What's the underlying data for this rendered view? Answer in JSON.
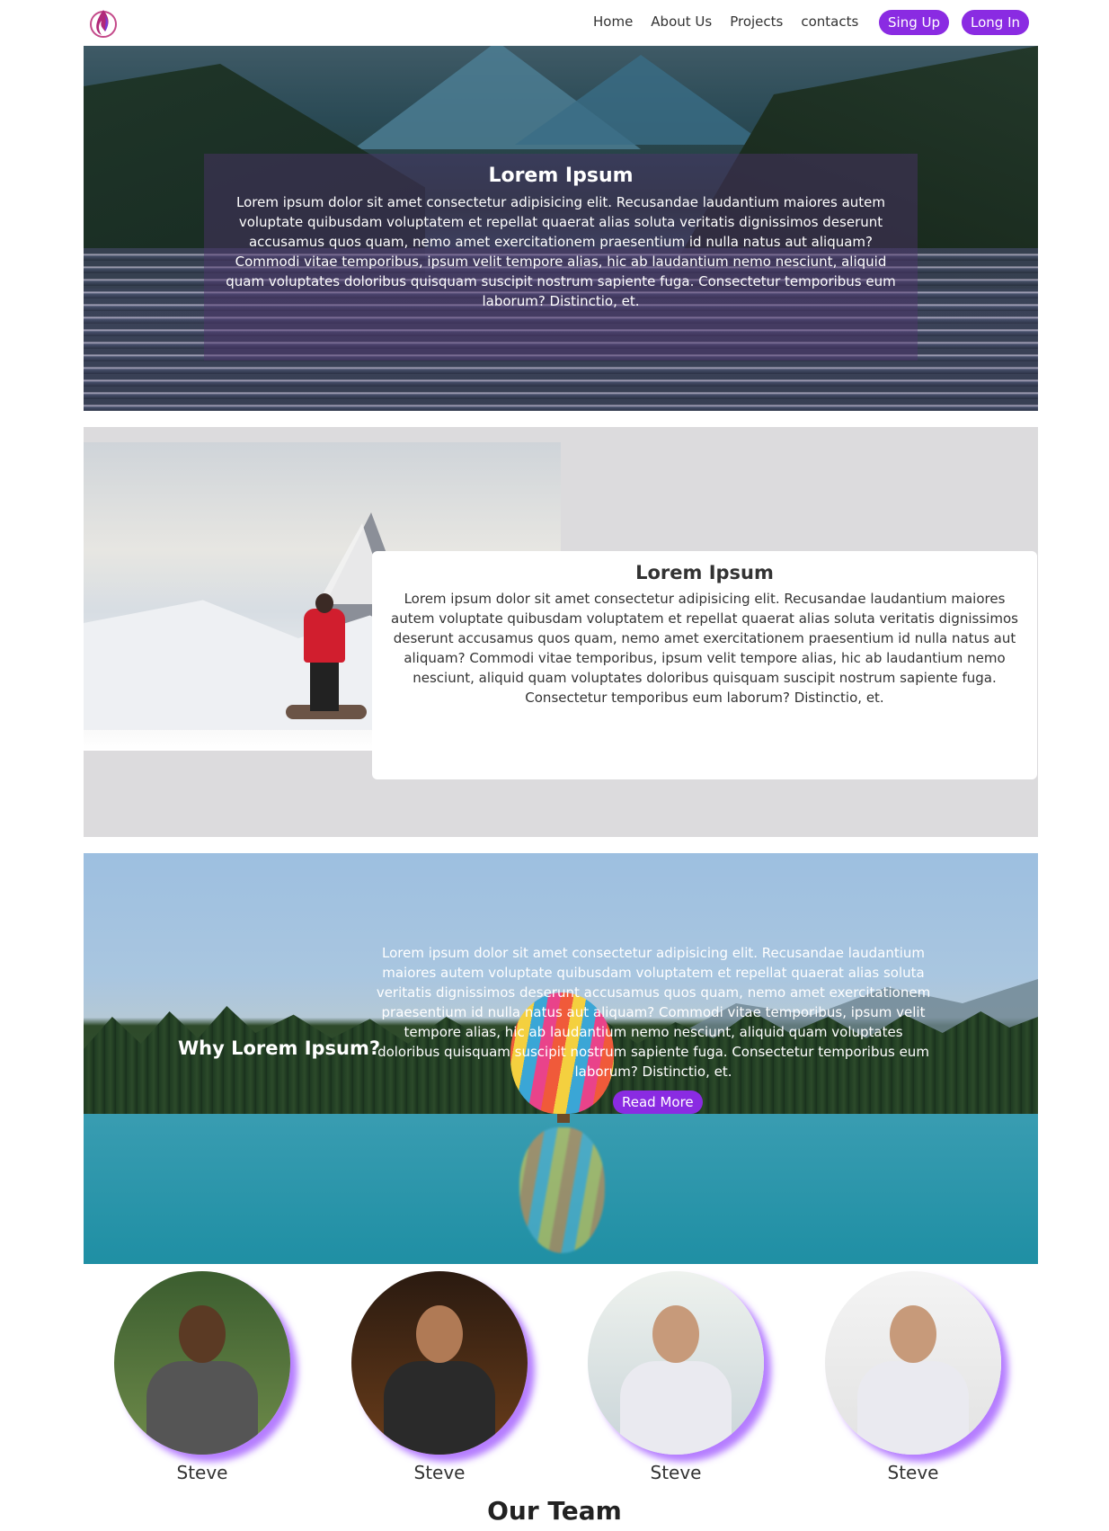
{
  "nav": {
    "links": [
      "Home",
      "About Us",
      "Projects",
      "contacts"
    ],
    "signup": "Sing Up",
    "login": "Long In",
    "accent": "#8a2be2"
  },
  "hero": {
    "title": "Lorem Ipsum",
    "text": "Lorem ipsum dolor sit amet consectetur adipisicing elit. Recusandae laudantium maiores autem voluptate quibusdam voluptatem et repellat quaerat alias soluta veritatis dignissimos deserunt accusamus quos quam, nemo amet exercitationem praesentium id nulla natus aut aliquam? Commodi vitae temporibus, ipsum velit tempore alias, hic ab laudantium nemo nesciunt, aliquid quam voluptates doloribus quisquam suscipit nostrum sapiente fuga. Consectetur temporibus eum laborum? Distinctio, et."
  },
  "about": {
    "title": "Lorem Ipsum",
    "text": "Lorem ipsum dolor sit amet consectetur adipisicing elit. Recusandae laudantium maiores autem voluptate quibusdam voluptatem et repellat quaerat alias soluta veritatis dignissimos deserunt accusamus quos quam, nemo amet exercitationem praesentium id nulla natus aut aliquam? Commodi vitae temporibus, ipsum velit tempore alias, hic ab laudantium nemo nesciunt, aliquid quam voluptates doloribus quisquam suscipit nostrum sapiente fuga. Consectetur temporibus eum laborum? Distinctio, et."
  },
  "why": {
    "title": "Why Lorem Ipsum?",
    "text": "Lorem ipsum dolor sit amet consectetur adipisicing elit. Recusandae laudantium maiores autem voluptate quibusdam voluptatem et repellat quaerat alias soluta veritatis dignissimos deserunt accusamus quos quam, nemo amet exercitationem praesentium id nulla natus aut aliquam? Commodi vitae temporibus, ipsum velit tempore alias, hic ab laudantium nemo nesciunt, aliquid quam voluptates doloribus quisquam suscipit nostrum sapiente fuga. Consectetur temporibus eum laborum? Distinctio, et.",
    "button": "Read More"
  },
  "team": {
    "title": "Our Team",
    "members": [
      {
        "name": "Steve"
      },
      {
        "name": "Steve"
      },
      {
        "name": "Steve"
      },
      {
        "name": "Steve"
      }
    ]
  }
}
